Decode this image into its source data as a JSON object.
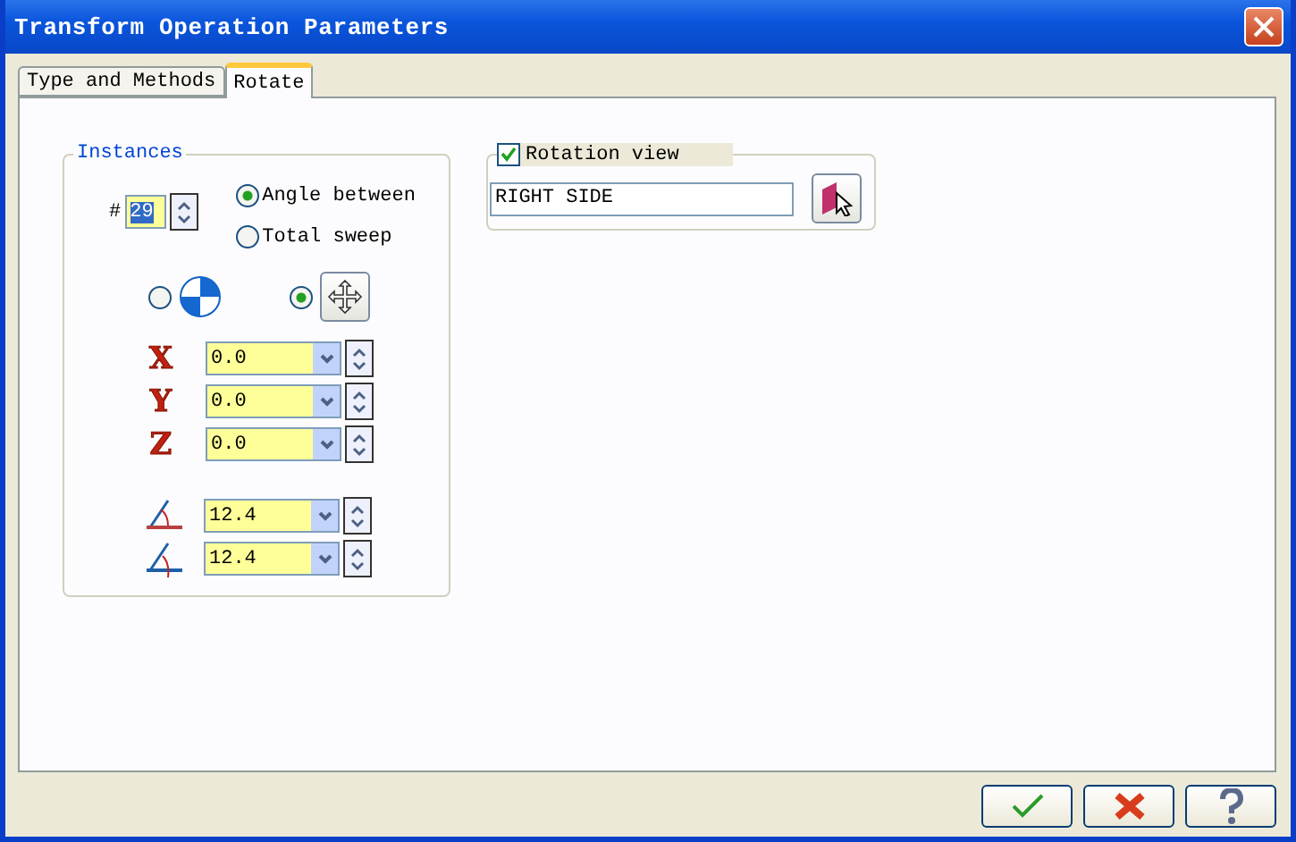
{
  "window": {
    "title": "Transform Operation Parameters"
  },
  "tabs": [
    {
      "label": "Type and Methods",
      "selected": false
    },
    {
      "label": "Rotate",
      "selected": true
    }
  ],
  "instances": {
    "title": "Instances",
    "count_label": "#",
    "count": "29",
    "modes": [
      {
        "label": "Angle between",
        "selected": true
      },
      {
        "label": "Total sweep",
        "selected": false
      }
    ],
    "pivots": [
      {
        "kind": "quadrant",
        "selected": false
      },
      {
        "kind": "move",
        "selected": true
      }
    ],
    "axes": [
      {
        "label": "X",
        "value": "0.0"
      },
      {
        "label": "Y",
        "value": "0.0"
      },
      {
        "label": "Z",
        "value": "0.0"
      }
    ],
    "angles": [
      {
        "kind": "upper",
        "value": "12.4"
      },
      {
        "kind": "lower",
        "value": "12.4"
      }
    ]
  },
  "rotation_view": {
    "label": "Rotation view",
    "checked": true,
    "value": "RIGHT SIDE"
  },
  "buttons": [
    {
      "kind": "ok"
    },
    {
      "kind": "cancel"
    },
    {
      "kind": "help"
    }
  ]
}
